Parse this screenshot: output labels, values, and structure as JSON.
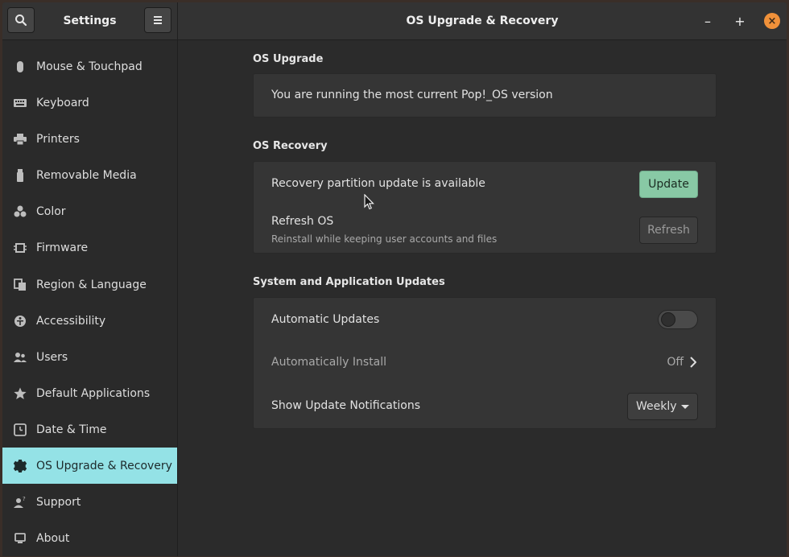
{
  "sidebar_header": {
    "title": "Settings"
  },
  "main_header": {
    "title": "OS Upgrade & Recovery"
  },
  "window_controls": {
    "minimize": "–",
    "maximize": "+",
    "close": "×"
  },
  "sidebar": {
    "items": [
      {
        "label": "Mouse & Touchpad",
        "icon": "mouse-icon"
      },
      {
        "label": "Keyboard",
        "icon": "keyboard-icon"
      },
      {
        "label": "Printers",
        "icon": "printer-icon"
      },
      {
        "label": "Removable Media",
        "icon": "usb-drive-icon"
      },
      {
        "label": "Color",
        "icon": "color-icon"
      },
      {
        "label": "Firmware",
        "icon": "chip-icon"
      },
      {
        "label": "Region & Language",
        "icon": "language-icon"
      },
      {
        "label": "Accessibility",
        "icon": "accessibility-icon"
      },
      {
        "label": "Users",
        "icon": "users-icon"
      },
      {
        "label": "Default Applications",
        "icon": "star-icon"
      },
      {
        "label": "Date & Time",
        "icon": "clock-icon"
      },
      {
        "label": "OS Upgrade & Recovery",
        "icon": "gear-icon",
        "active": true
      },
      {
        "label": "Support",
        "icon": "support-icon"
      },
      {
        "label": "About",
        "icon": "info-icon"
      }
    ]
  },
  "os_upgrade": {
    "title": "OS Upgrade",
    "message": "You are running the most current Pop!_OS version"
  },
  "os_recovery": {
    "title": "OS Recovery",
    "update_row": {
      "label": "Recovery partition update is available",
      "button": "Update"
    },
    "refresh_row": {
      "label": "Refresh OS",
      "sublabel": "Reinstall while keeping user accounts and files",
      "button": "Refresh"
    }
  },
  "updates": {
    "title": "System and Application Updates",
    "automatic_updates": {
      "label": "Automatic Updates",
      "enabled": false
    },
    "automatically_install": {
      "label": "Automatically Install",
      "value": "Off"
    },
    "notifications": {
      "label": "Show Update Notifications",
      "value": "Weekly"
    }
  },
  "colors": {
    "accent": "#94e2e6",
    "update_button": "#88c9a5",
    "close_button": "#f0913a"
  }
}
